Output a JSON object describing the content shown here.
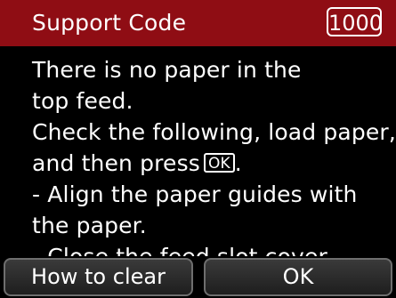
{
  "header": {
    "title": "Support Code",
    "code": "1000"
  },
  "message": {
    "lines": [
      "There is no paper in the",
      "top feed.",
      "Check the following, load paper,",
      "and then press",
      "- Align the paper guides with",
      "the paper.",
      "- Close the feed slot cover."
    ],
    "key_label": "OK",
    "line4_end": "."
  },
  "buttons": {
    "left_label": "How to clear",
    "right_label": "OK"
  },
  "colors": {
    "title_bar": "#8f0d14",
    "background": "#000000",
    "text": "#ffffff"
  }
}
